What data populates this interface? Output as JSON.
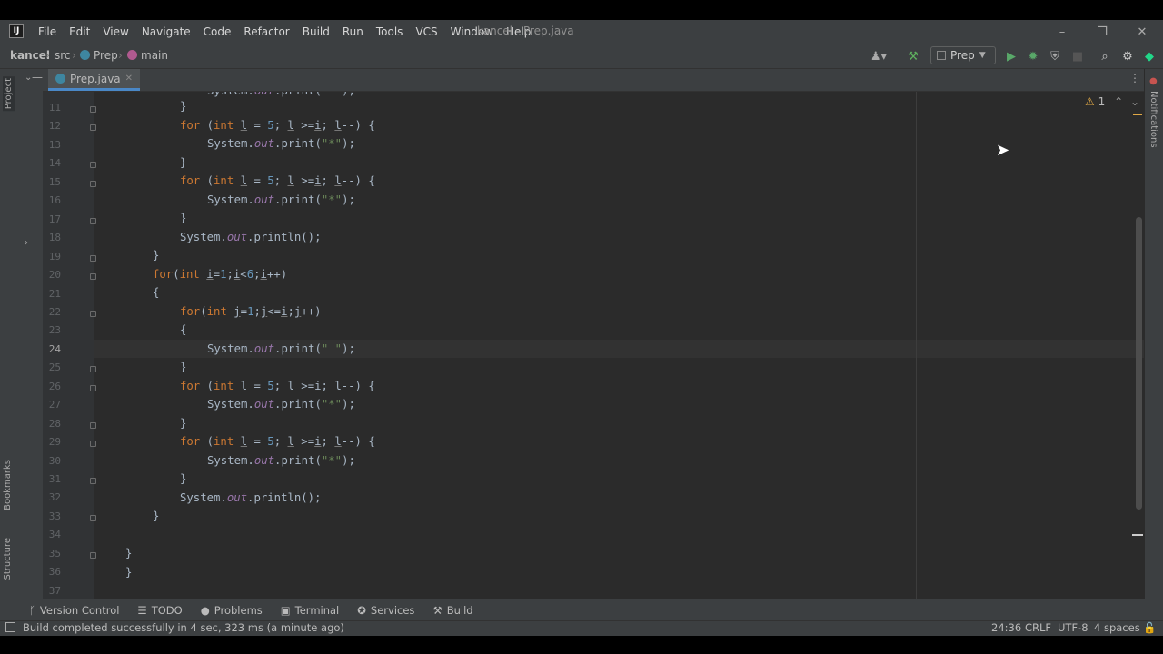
{
  "app": {
    "logo": "IJ",
    "window_title": "kancel - Prep.java",
    "menu": [
      "File",
      "Edit",
      "View",
      "Navigate",
      "Code",
      "Refactor",
      "Build",
      "Run",
      "Tools",
      "VCS",
      "Window",
      "Help"
    ],
    "window_controls": {
      "minimize": "–",
      "restore": "❐",
      "close": "✕"
    }
  },
  "breadcrumb": {
    "project": "kancel",
    "folder": "src",
    "class": "Prep",
    "method": "main",
    "class_icon": "c-class-icon",
    "method_icon": "m-method-icon"
  },
  "toolbar": {
    "run_config": "Prep",
    "icons": [
      "user-icon",
      "hammer-icon",
      "run-icon",
      "debug-icon",
      "coverage-icon",
      "stop-icon",
      "search-icon",
      "settings-icon",
      "jetbrains-icon"
    ]
  },
  "side_tabs": {
    "left": [
      "Project",
      "Bookmarks",
      "Structure"
    ],
    "right": [
      "Notifications"
    ]
  },
  "editor": {
    "tab_label": "Prep.java",
    "inspection_warnings": "1",
    "current_line": "24",
    "line_numbers": [
      "11",
      "12",
      "13",
      "14",
      "15",
      "16",
      "17",
      "18",
      "19",
      "20",
      "21",
      "22",
      "23",
      "24",
      "25",
      "26",
      "27",
      "28",
      "29",
      "30",
      "31",
      "32",
      "33",
      "34",
      "35",
      "36",
      "37"
    ]
  },
  "tool_windows": [
    "Version Control",
    "TODO",
    "Problems",
    "Terminal",
    "Services",
    "Build"
  ],
  "status": {
    "message": "Build completed successfully in 4 sec, 323 ms (a minute ago)",
    "position": "24:36",
    "line_separator": "CRLF",
    "encoding": "UTF-8",
    "indent": "4 spaces"
  },
  "colors": {
    "keyword": "#cc7832",
    "number": "#6897bb",
    "string": "#6a8759",
    "static_field": "#9876aa",
    "editor_bg": "#2b2b2b",
    "chrome_bg": "#3c3f41"
  }
}
